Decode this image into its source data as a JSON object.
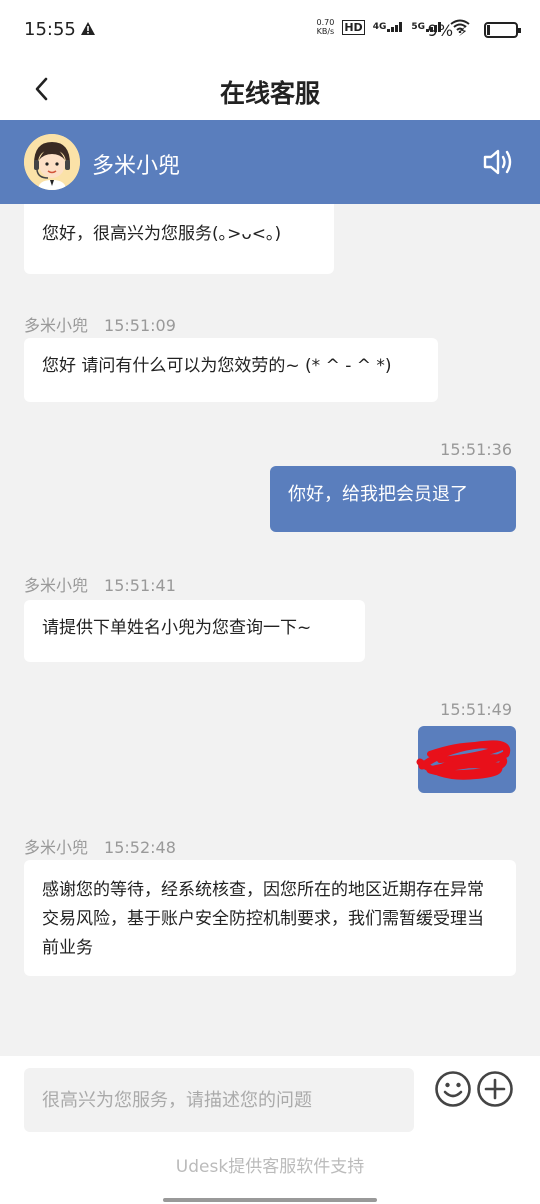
{
  "status_bar": {
    "time": "15:55",
    "speed_value": "0.70",
    "speed_unit": "KB/s",
    "hd": "HD",
    "net1": "4G",
    "net2": "5G",
    "battery": "9%"
  },
  "nav": {
    "title": "在线客服"
  },
  "agent": {
    "name": "多米小兜"
  },
  "messages": [
    {
      "direction": "in",
      "text": "您好，很高兴为您服务(｡>ᴗ<｡)"
    },
    {
      "direction": "in",
      "sender": "多米小兜",
      "time": "15:51:09",
      "text": "您好 请问有什么可以为您效劳的~ (* ^ - ^ *)"
    },
    {
      "direction": "out",
      "time": "15:51:36",
      "text": "你好，给我把会员退了"
    },
    {
      "direction": "in",
      "sender": "多米小兜",
      "time": "15:51:41",
      "text": "请提供下单姓名小兜为您查询一下~"
    },
    {
      "direction": "out",
      "time": "15:51:49",
      "text": ""
    },
    {
      "direction": "in",
      "sender": "多米小兜",
      "time": "15:52:48",
      "text": "感谢您的等待，经系统核查，因您所在的地区近期存在异常交易风险，基于账户安全防控机制要求，我们需暂缓受理当前业务"
    }
  ],
  "input": {
    "placeholder": "很高兴为您服务，请描述您的问题"
  },
  "footer": {
    "powered": "Udesk提供客服软件支持"
  },
  "colors": {
    "accent": "#5a7ebd",
    "background": "#f2f2f2",
    "redaction": "#e8101a"
  }
}
